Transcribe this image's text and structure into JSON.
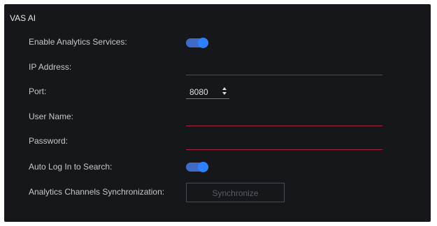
{
  "panel": {
    "title": "VAS AI"
  },
  "rows": {
    "enable_analytics": {
      "label": "Enable Analytics Services:",
      "enabled": true
    },
    "ip_address": {
      "label": "IP Address:",
      "value": ""
    },
    "port": {
      "label": "Port:",
      "value": "8080"
    },
    "user_name": {
      "label": "User Name:",
      "value": ""
    },
    "password": {
      "label": "Password:",
      "value": ""
    },
    "auto_login": {
      "label": "Auto Log In to Search:",
      "enabled": true
    },
    "channel_sync": {
      "label": "Analytics Channels Synchronization:",
      "button_label": "Synchronize"
    }
  },
  "colors": {
    "panel_background": "#16171b",
    "toggle_on": "#3e6bc5",
    "toggle_knob": "#2f80ff",
    "error_underline": "#a8243a",
    "focus_underline": "#2f80ff",
    "button_border": "#4a4b52",
    "button_text_disabled": "#5b5c63"
  },
  "icons": {
    "port_spinner": "spinner-up-down-icon"
  }
}
